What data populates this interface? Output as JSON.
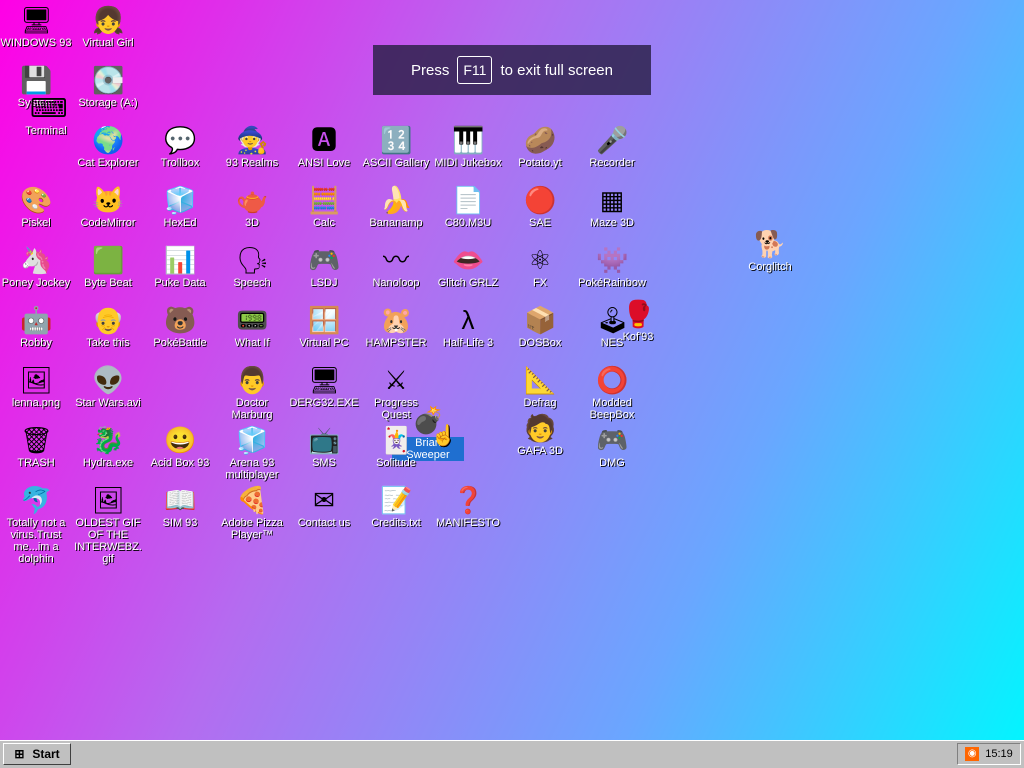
{
  "notice": {
    "press": "Press",
    "key": "F11",
    "rest": "to exit full screen"
  },
  "desktop": {
    "icons": [
      {
        "label": "WINDOWS 93",
        "glyph": "🖥"
      },
      {
        "label": "Virtual Girl",
        "glyph": "👧"
      },
      {
        "label": "System",
        "glyph": "💾"
      },
      {
        "label": "Terminal",
        "glyph": "⌨"
      },
      {
        "label": "Storage (A:)",
        "glyph": "💽"
      },
      {
        "label": "Cat Explorer",
        "glyph": "🌍"
      },
      {
        "label": "Trollbox",
        "glyph": "💬"
      },
      {
        "label": "93 Realms",
        "glyph": "🧙"
      },
      {
        "label": "ANSI Love",
        "glyph": "🅰"
      },
      {
        "label": "ASCII Gallery",
        "glyph": "🔢"
      },
      {
        "label": "MIDI Jukebox",
        "glyph": "🎹"
      },
      {
        "label": "Potato.yt",
        "glyph": "🥔"
      },
      {
        "label": "Recorder",
        "glyph": "🎤"
      },
      {
        "label": "Piskel",
        "glyph": "🎨"
      },
      {
        "label": "CodeMirror",
        "glyph": "🐱"
      },
      {
        "label": "HexEd",
        "glyph": "🧊"
      },
      {
        "label": "3D",
        "glyph": "🫖"
      },
      {
        "label": "Calc",
        "glyph": "🧮"
      },
      {
        "label": "Bananamp",
        "glyph": "🍌"
      },
      {
        "label": "C80.M3U",
        "glyph": "📄"
      },
      {
        "label": "SAE",
        "glyph": "🔴"
      },
      {
        "label": "Maze 3D",
        "glyph": "▦"
      },
      {
        "label": "Corglitch",
        "glyph": "🐕"
      },
      {
        "label": "Poney Jockey",
        "glyph": "🦄"
      },
      {
        "label": "Byte Beat",
        "glyph": "🟩"
      },
      {
        "label": "Puke Data",
        "glyph": "📊"
      },
      {
        "label": "Speech",
        "glyph": "🗣"
      },
      {
        "label": "LSDJ",
        "glyph": "🎮"
      },
      {
        "label": "Nanoloop",
        "glyph": "〰"
      },
      {
        "label": "Glitch GRLZ",
        "glyph": "👄"
      },
      {
        "label": "FX",
        "glyph": "⚛"
      },
      {
        "label": "PokéRainbow",
        "glyph": "👾"
      },
      {
        "label": "Robby",
        "glyph": "🤖"
      },
      {
        "label": "Take this",
        "glyph": "👴"
      },
      {
        "label": "PokéBattle",
        "glyph": "🐻"
      },
      {
        "label": "What If",
        "glyph": "📟"
      },
      {
        "label": "Virtual PC",
        "glyph": "🪟"
      },
      {
        "label": "HAMPSTER",
        "glyph": "🐹"
      },
      {
        "label": "Half-Life 3",
        "glyph": "λ"
      },
      {
        "label": "DOSBox",
        "glyph": "📦"
      },
      {
        "label": "NES",
        "glyph": "🕹"
      },
      {
        "label": "Kof'93",
        "glyph": "🥊"
      },
      {
        "label": "lenna.png",
        "glyph": "🖼"
      },
      {
        "label": "Star Wars.avi",
        "glyph": "👽"
      },
      {
        "label": "Doctor Marburg",
        "glyph": "👨"
      },
      {
        "label": "DERG32.EXE",
        "glyph": "🖥"
      },
      {
        "label": "Progress Quest",
        "glyph": "⚔"
      },
      {
        "label": "Brian Sweeper",
        "glyph": "💣"
      },
      {
        "label": "Defrag",
        "glyph": "📐"
      },
      {
        "label": "Modded BeepBox",
        "glyph": "⭕"
      },
      {
        "label": "TRASH",
        "glyph": "🗑"
      },
      {
        "label": "Hydra.exe",
        "glyph": "🐉"
      },
      {
        "label": "Acid Box 93",
        "glyph": "😀"
      },
      {
        "label": "Arena 93 multiplayer",
        "glyph": "🧊"
      },
      {
        "label": "SMS",
        "glyph": "📺"
      },
      {
        "label": "Solitude",
        "glyph": "🃏"
      },
      {
        "label": "GAFA 3D",
        "glyph": "🧑"
      },
      {
        "label": "DMG",
        "glyph": "🎮"
      },
      {
        "label": "Totally not a virus.Trust me...im a dolphin",
        "glyph": "🐬"
      },
      {
        "label": "OLDEST GIF OF THE INTERWEBZ.gif",
        "glyph": "🖼"
      },
      {
        "label": "SIM 93",
        "glyph": "📖"
      },
      {
        "label": "Adobe Pizza Player™",
        "glyph": "🍕"
      },
      {
        "label": "Contact us",
        "glyph": "✉"
      },
      {
        "label": "Credits.txt",
        "glyph": "📝"
      },
      {
        "label": "MANIFESTO",
        "glyph": "❓"
      }
    ]
  },
  "taskbar": {
    "start_label": "Start",
    "clock": "15:19",
    "tray_icon": "rss-icon"
  },
  "colors": {
    "selection": "#1f6fd0",
    "taskbar": "#c0c0c0"
  }
}
